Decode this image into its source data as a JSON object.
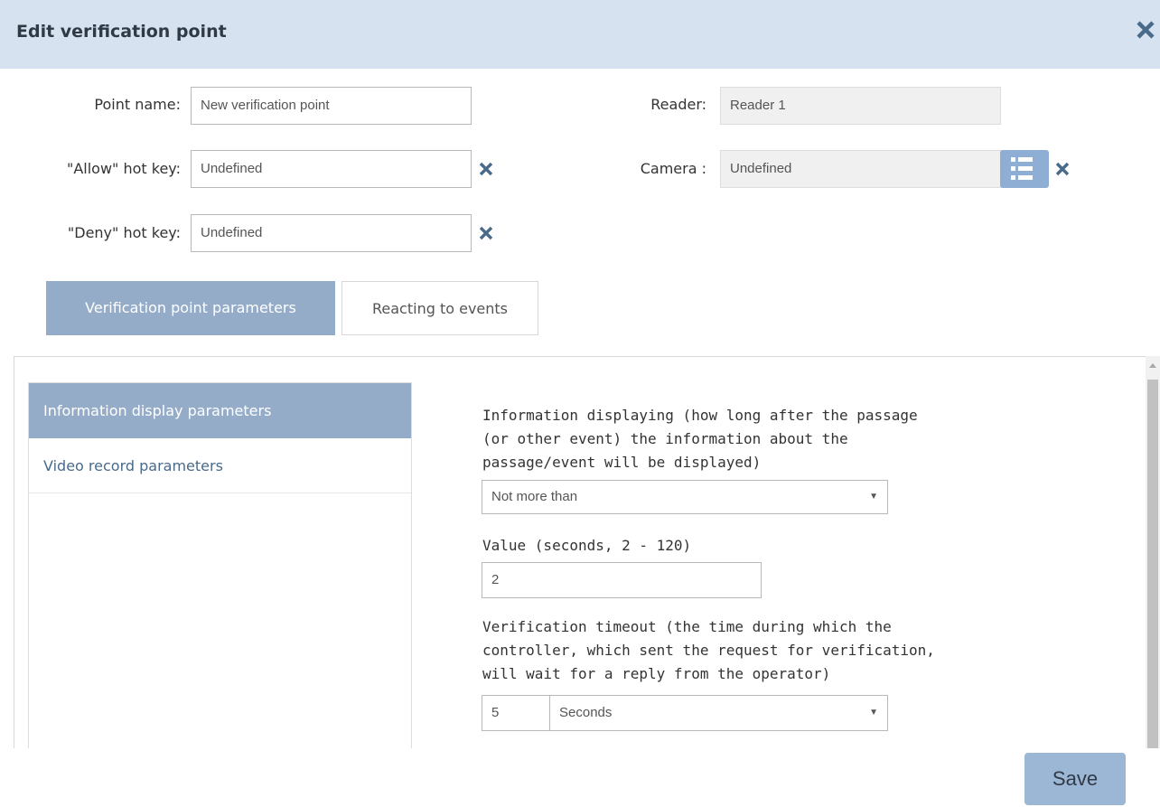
{
  "dialog": {
    "title": "Edit verification point"
  },
  "form": {
    "point_name_label": "Point name:",
    "point_name_value": "New verification point",
    "reader_label": "Reader:",
    "reader_value": "Reader 1",
    "allow_label": "\"Allow\" hot key:",
    "allow_value": "Undefined",
    "camera_label": "Camera :",
    "camera_value": "Undefined",
    "deny_label": "\"Deny\" hot key:",
    "deny_value": "Undefined"
  },
  "tabs": [
    {
      "label": "Verification point parameters",
      "active": true
    },
    {
      "label": "Reacting to events",
      "active": false
    }
  ],
  "sidenav": [
    {
      "label": "Information display parameters",
      "active": true
    },
    {
      "label": "Video record parameters",
      "active": false
    }
  ],
  "params": {
    "info_desc_lines": [
      "Information displaying (how long after the passage",
      "(or other event) the information about the",
      "passage/event will be displayed)"
    ],
    "info_select": "Not more than",
    "value_label": "Value (seconds, 2 - 120)",
    "value_input": "2",
    "timeout_desc_lines": [
      "Verification timeout (the time during which the",
      "controller, which sent the request for verification,",
      "will wait for a reply from the operator)"
    ],
    "timeout_value": "5",
    "timeout_unit": "Seconds"
  },
  "footer": {
    "save_label": "Save"
  },
  "icons": {
    "close": "close-icon",
    "clear": "clear-icon",
    "list": "list-icon",
    "dropdown": "chevron-down-icon"
  },
  "colors": {
    "header_bg": "#d6e2f0",
    "accent": "#95acc9",
    "button": "#9cb6d6",
    "icon": "#4a6a8a"
  }
}
